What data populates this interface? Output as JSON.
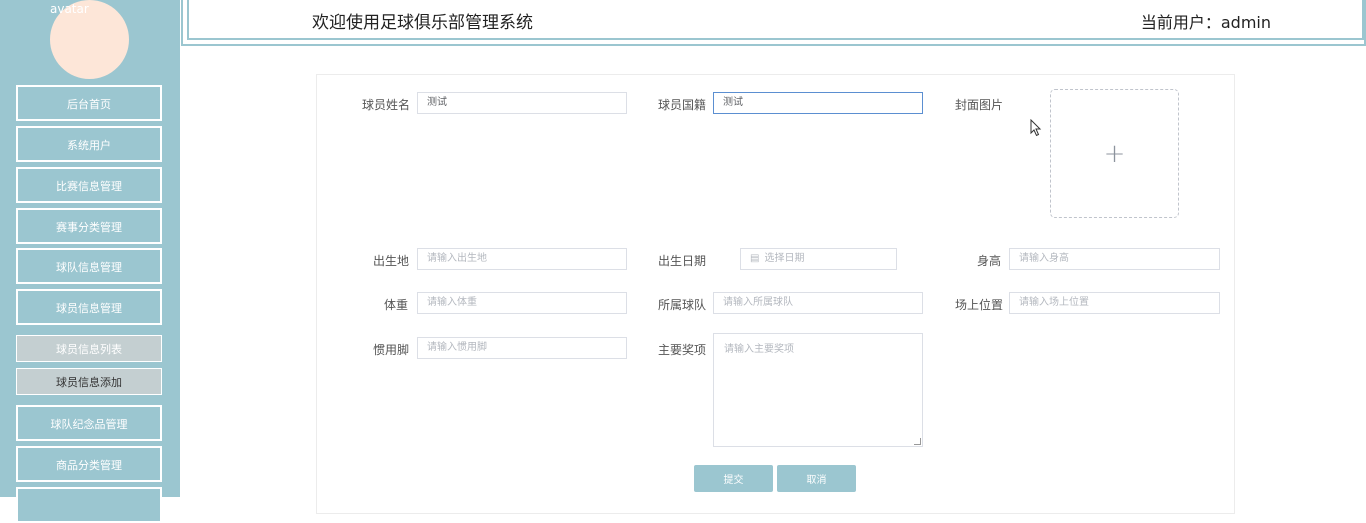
{
  "sidebar": {
    "avatar_alt": "avatar",
    "items": [
      {
        "label": "后台首页"
      },
      {
        "label": "系统用户"
      },
      {
        "label": "比赛信息管理"
      },
      {
        "label": "赛事分类管理"
      },
      {
        "label": "球队信息管理"
      },
      {
        "label": "球员信息管理"
      }
    ],
    "sub_items": [
      {
        "label": "球员信息列表"
      },
      {
        "label": "球员信息添加"
      }
    ],
    "items_after": [
      {
        "label": "球队纪念品管理"
      },
      {
        "label": "商品分类管理"
      }
    ]
  },
  "header": {
    "title": "欢迎使用足球俱乐部管理系统",
    "user": "当前用户：admin"
  },
  "form": {
    "name": {
      "label": "球员姓名",
      "value": "测试"
    },
    "nationality": {
      "label": "球员国籍",
      "value": "测试"
    },
    "cover": {
      "label": "封面图片",
      "icon": "plus-icon",
      "glyph": "+"
    },
    "birthplace": {
      "label": "出生地",
      "placeholder": "请输入出生地"
    },
    "birthdate": {
      "label": "出生日期",
      "placeholder": "选择日期",
      "icon": "calendar-icon"
    },
    "height": {
      "label": "身高",
      "placeholder": "请输入身高"
    },
    "weight": {
      "label": "体重",
      "placeholder": "请输入体重"
    },
    "team": {
      "label": "所属球队",
      "placeholder": "请输入所属球队"
    },
    "position": {
      "label": "场上位置",
      "placeholder": "请输入场上位置"
    },
    "foot": {
      "label": "惯用脚",
      "placeholder": "请输入惯用脚"
    },
    "awards": {
      "label": "主要奖项",
      "placeholder": "请输入主要奖项"
    }
  },
  "actions": {
    "submit": "提交",
    "cancel": "取消"
  },
  "colors": {
    "accent": "#9bc6d0",
    "avatar_bg": "#fde6d8",
    "sub_item_bg": "#c4cfd1",
    "focus_border": "#5b8fd1"
  }
}
